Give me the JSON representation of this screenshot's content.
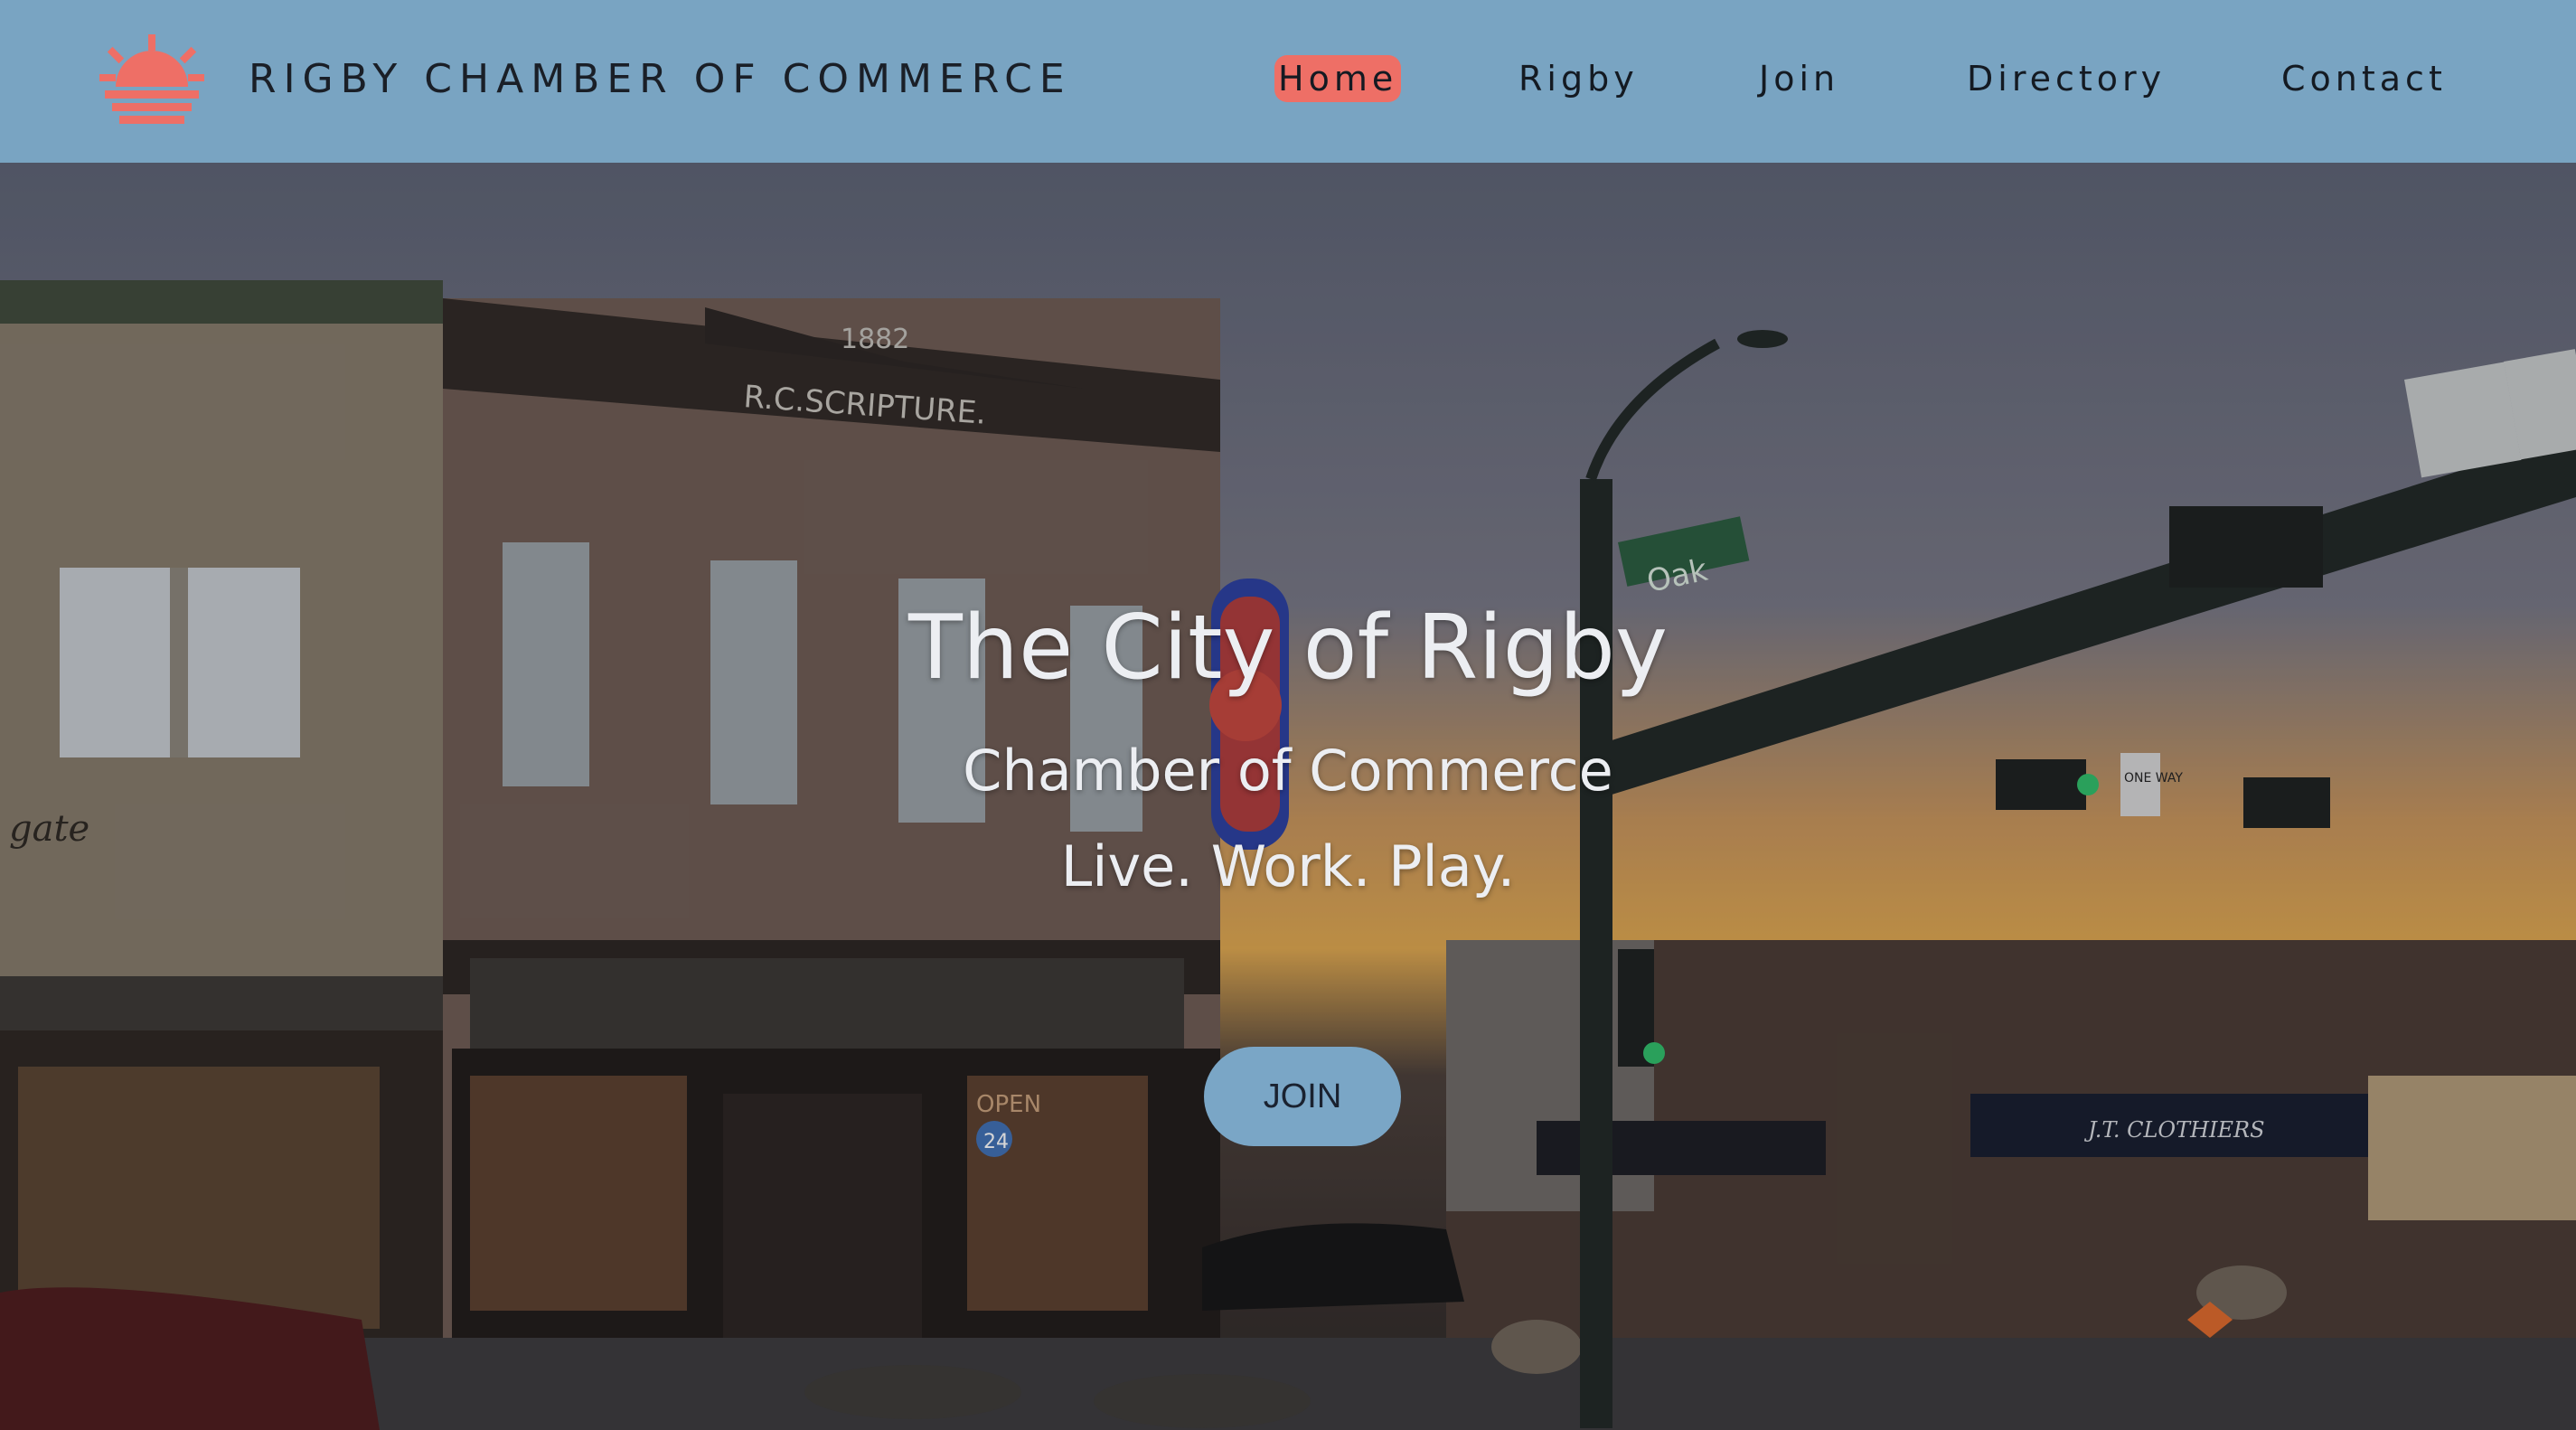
{
  "header": {
    "brand": "RIGBY CHAMBER OF COMMERCE",
    "logo_icon": "sunrise-icon",
    "nav": [
      {
        "label": "Home",
        "active": true
      },
      {
        "label": "Rigby",
        "active": false
      },
      {
        "label": "Join",
        "active": false
      },
      {
        "label": "Directory",
        "active": false
      },
      {
        "label": "Contact",
        "active": false
      }
    ]
  },
  "hero": {
    "title": "The City of Rigby",
    "subtitle": "Chamber of Commerce",
    "tagline": "Live. Work. Play.",
    "cta_label": "JOIN",
    "background_image": {
      "signs": {
        "building": "R.C.SCRIPTURE.",
        "year": "1882",
        "street": "Oak",
        "store": "J.T. CLOTHIERS",
        "one_way": "ONE WAY",
        "open_sign": "OPEN",
        "hours": "24",
        "gate": "gate"
      }
    }
  },
  "colors": {
    "header_bg": "#79a4c2",
    "accent": "#ee6f66",
    "button_bg": "#7aa6c6"
  }
}
